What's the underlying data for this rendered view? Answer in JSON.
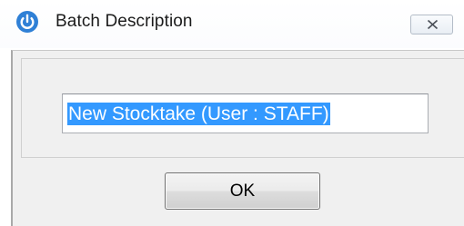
{
  "window": {
    "title": "Batch Description",
    "icon": "power-icon",
    "close_icon": "close-icon"
  },
  "form": {
    "description_value": "New Stocktake (User : STAFF)"
  },
  "buttons": {
    "ok_label": "OK"
  },
  "colors": {
    "selection_highlight": "#3399ff",
    "app_icon_blue": "#2f80d6"
  }
}
